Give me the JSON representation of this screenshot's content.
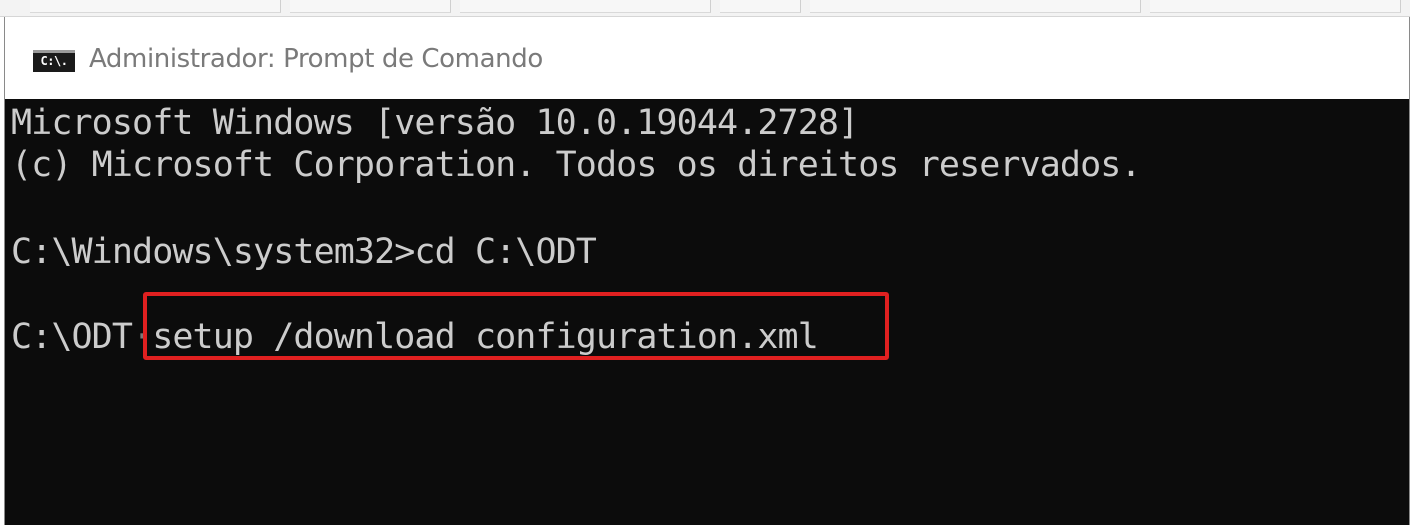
{
  "window": {
    "title": "Administrador: Prompt de Comando",
    "icon_label": "C:\\.",
    "icon": "cmd-icon"
  },
  "console": {
    "lines": [
      "Microsoft Windows [versão 10.0.19044.2728]",
      "(c) Microsoft Corporation. Todos os direitos reservados.",
      "",
      "C:\\Windows\\system32>cd C:\\ODT",
      "",
      "C:\\ODT>setup /download configuration.xml"
    ],
    "prompt_odt": "C:\\ODT",
    "command_highlighted": "setup /download configuration.xml"
  },
  "colors": {
    "console_bg": "#0c0c0c",
    "console_text": "#cccccc",
    "highlight_border": "#e02020",
    "titlebar_bg": "#ffffff",
    "title_text": "#7a7a7a"
  }
}
